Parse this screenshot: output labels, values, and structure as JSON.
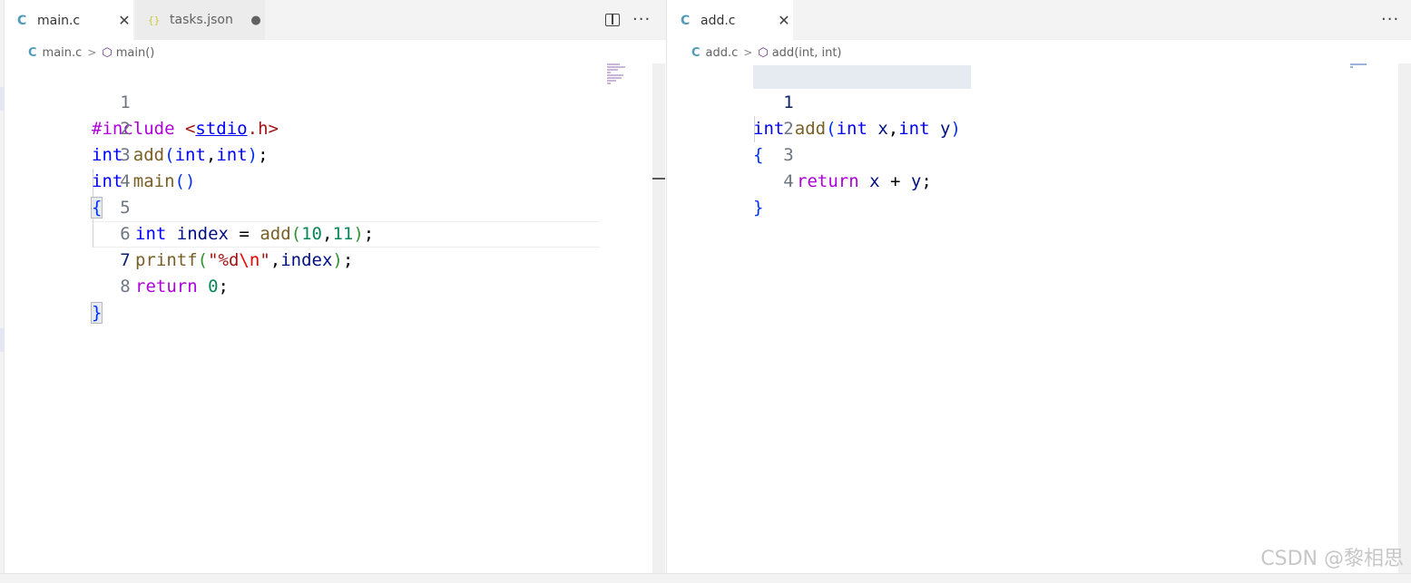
{
  "left_pane": {
    "tabs": [
      {
        "icon": "C",
        "label": "main.c",
        "state": "active",
        "close": "✕"
      },
      {
        "icon": "{}",
        "label": "tasks.json",
        "state": "modified",
        "dot": "●"
      }
    ],
    "breadcrumb": {
      "file_icon": "C",
      "file": "main.c",
      "symbol_icon": "cube-icon",
      "symbol": "main()"
    },
    "active_line": 7,
    "lines": [
      {
        "num": "1"
      },
      {
        "num": "2"
      },
      {
        "num": "3"
      },
      {
        "num": "4"
      },
      {
        "num": "5"
      },
      {
        "num": "6"
      },
      {
        "num": "7"
      },
      {
        "num": "8"
      }
    ],
    "tokens": {
      "l1": [
        "#include",
        " ",
        "<",
        "stdio",
        ".h",
        ">"
      ],
      "l2": [
        "int",
        " ",
        "add",
        "(",
        "int",
        ",",
        "int",
        ")",
        ";"
      ],
      "l3": [
        "int",
        " ",
        "main",
        "()"
      ],
      "l4": [
        "{"
      ],
      "l5": [
        "int",
        " ",
        "index",
        " = ",
        "add",
        "(",
        "10",
        ",",
        "11",
        ")",
        ";"
      ],
      "l6": [
        "printf",
        "(",
        "\"%d",
        "\\n",
        "\"",
        ",",
        "index",
        ")",
        ";"
      ],
      "l7": [
        "return",
        " ",
        "0",
        ";"
      ],
      "l8": [
        "}"
      ]
    }
  },
  "right_pane": {
    "tabs": [
      {
        "icon": "C",
        "label": "add.c",
        "state": "active",
        "close": "✕"
      }
    ],
    "breadcrumb": {
      "file_icon": "C",
      "file": "add.c",
      "symbol_icon": "cube-icon",
      "symbol": "add(int, int)"
    },
    "active_line": 1,
    "lines": [
      {
        "num": "1"
      },
      {
        "num": "2"
      },
      {
        "num": "3"
      },
      {
        "num": "4"
      }
    ],
    "tokens": {
      "l1": [
        "int",
        " ",
        "add",
        "(",
        "int",
        " x",
        ",",
        "int",
        " y",
        ")"
      ],
      "l2": [
        "{"
      ],
      "l3": [
        "return",
        " ",
        "x",
        " + ",
        "y",
        ";"
      ],
      "l4": [
        "}"
      ]
    }
  },
  "actions": {
    "split": "split-editor-icon",
    "more": "···"
  },
  "watermark": "CSDN @黎相思",
  "colors": {
    "keyword": "#0000ff",
    "control": "#af00db",
    "function": "#795e26",
    "string": "#a31515",
    "number": "#098658",
    "variable": "#001080"
  }
}
